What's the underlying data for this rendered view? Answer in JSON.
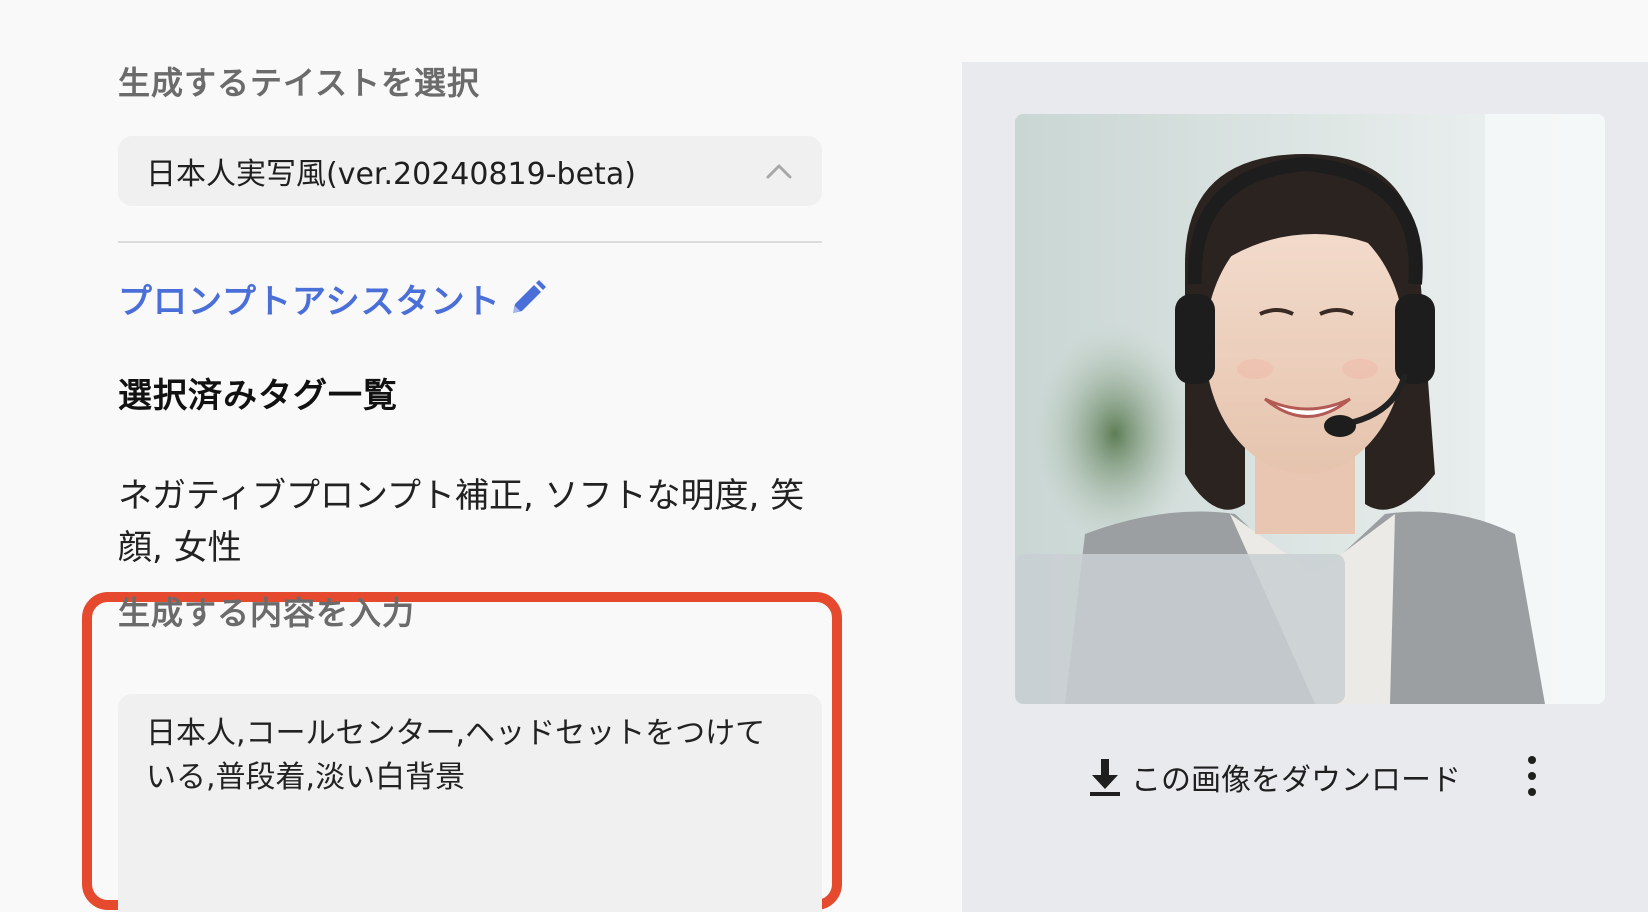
{
  "taste": {
    "label": "生成するテイストを選択",
    "selected": "日本人実写風(ver.20240819-beta)"
  },
  "assistant": {
    "link_label": "プロンプトアシスタント"
  },
  "tags": {
    "heading": "選択済みタグ一覧",
    "list": "ネガティブプロンプト補正, ソフトな明度, 笑顔, 女性"
  },
  "content": {
    "label": "生成する内容を入力",
    "value": "日本人,コールセンター,ヘッドセットをつけている,普段着,淡い白背景"
  },
  "preview": {
    "download_label": "この画像をダウンロード"
  },
  "colors": {
    "accent_link": "#4a6fd8",
    "highlight_border": "#e64a2e"
  },
  "icons": [
    "chevron-up-icon",
    "pencil-icon",
    "download-icon",
    "more-vertical-icon"
  ]
}
